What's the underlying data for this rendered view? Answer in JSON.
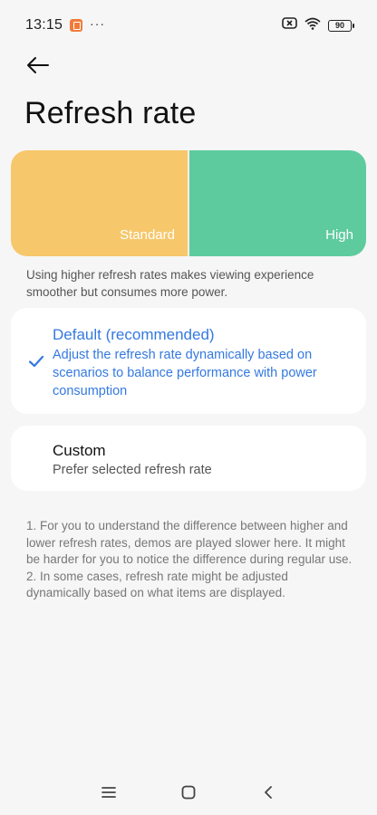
{
  "status_bar": {
    "time": "13:15",
    "app_icon": "note-app-icon",
    "more": "···",
    "battery_level": "90",
    "icons": [
      "sim-off-icon",
      "wifi-icon",
      "battery-icon"
    ]
  },
  "header": {
    "back_icon": "arrow-left-icon",
    "title": "Refresh rate"
  },
  "demo": {
    "standard_label": "Standard",
    "high_label": "High",
    "colors": {
      "standard": "#f7c76b",
      "high": "#5ecb9e"
    }
  },
  "intro_text": "Using higher refresh rates makes viewing experience smoother but consumes more power.",
  "options": {
    "default": {
      "title": "Default (recommended)",
      "subtitle": "Adjust the refresh rate dynamically based on scenarios to balance performance with power consumption",
      "selected": true
    },
    "custom": {
      "title": "Custom",
      "subtitle": "Prefer selected refresh rate",
      "selected": false
    }
  },
  "notes": {
    "note1": "1. For you to understand the difference between higher and lower refresh rates, demos are played slower here. It might be harder for you to notice the difference during regular use.",
    "note2": "2. In some cases, refresh rate might be adjusted dynamically based on what items are displayed."
  },
  "nav_bar": {
    "icons": [
      "menu-icon",
      "home-icon",
      "back-icon"
    ]
  },
  "accent_color": "#3479e0"
}
